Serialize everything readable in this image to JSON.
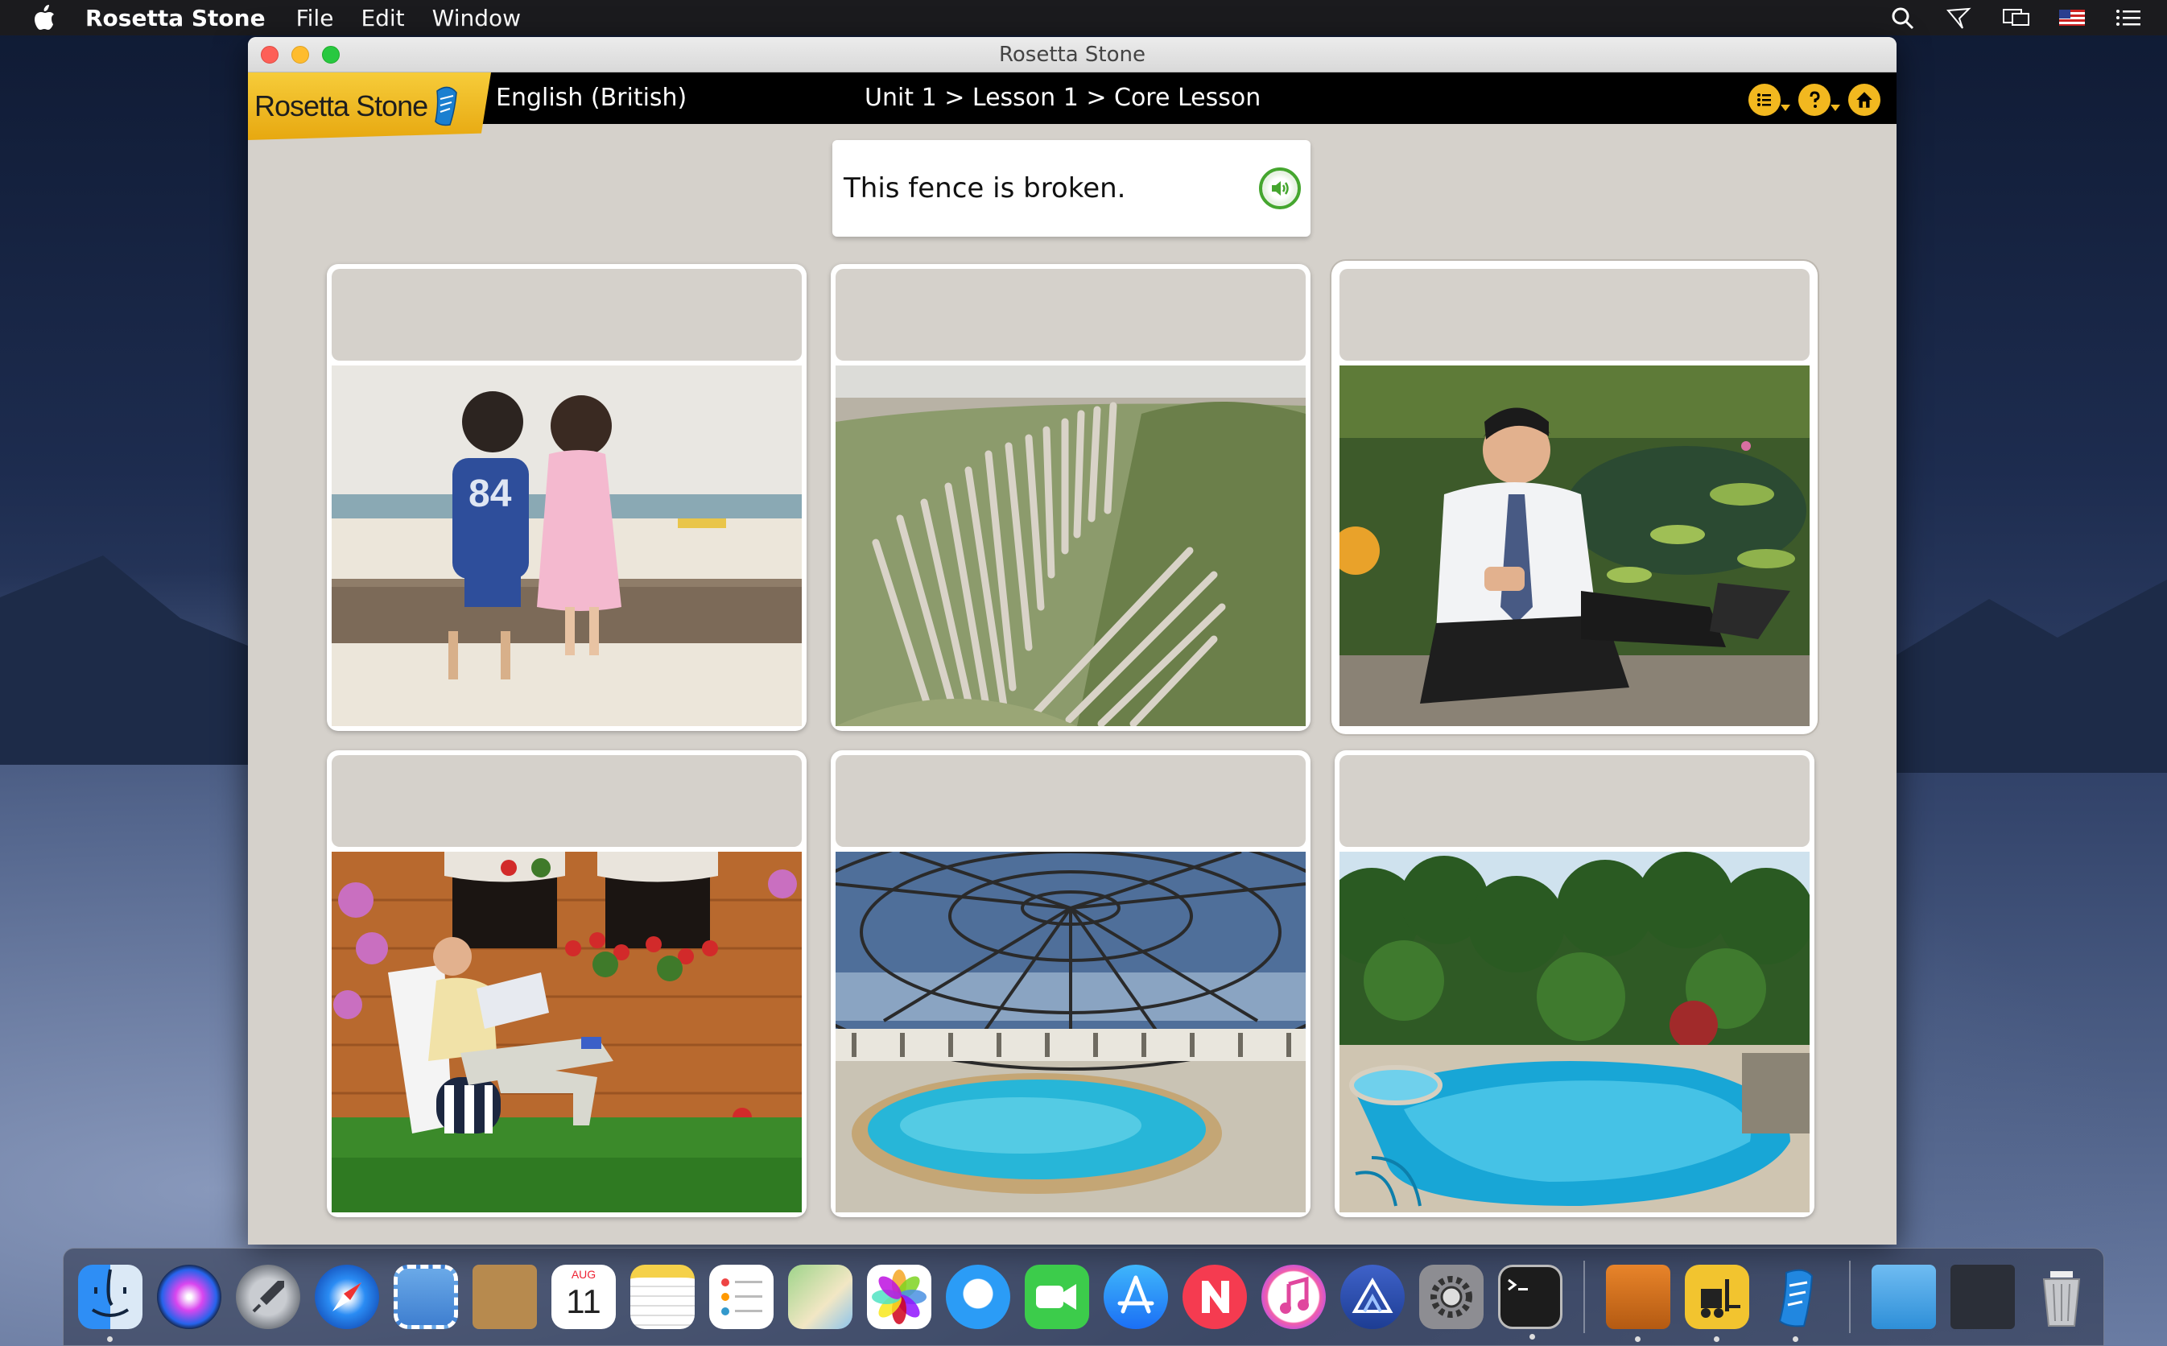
{
  "menubar": {
    "app_name": "Rosetta Stone",
    "menus": [
      "File",
      "Edit",
      "Window"
    ]
  },
  "window": {
    "title": "Rosetta Stone"
  },
  "app": {
    "logo_text": "Rosetta Stone",
    "course": "English (British)",
    "breadcrumb": "Unit 1 > Lesson 1 > Core Lesson"
  },
  "prompt": {
    "text": "This fence is broken."
  },
  "cards": [
    {
      "name": "two-children-on-beach-bench",
      "selected": false
    },
    {
      "name": "broken-fence-in-dunes",
      "selected": false
    },
    {
      "name": "man-with-laptop-by-pond",
      "selected": true
    },
    {
      "name": "man-reading-in-garden-chair",
      "selected": false
    },
    {
      "name": "indoor-pool-under-dome",
      "selected": false
    },
    {
      "name": "outdoor-pool-in-garden",
      "selected": false
    }
  ],
  "dock": {
    "calendar_month": "AUG",
    "calendar_day": "11",
    "apps": [
      "finder",
      "siri",
      "launchpad",
      "safari",
      "mail",
      "contacts",
      "calendar",
      "notes",
      "reminders",
      "maps",
      "photos",
      "messages",
      "facetime",
      "app-store",
      "news",
      "itunes",
      "affinity",
      "system-preferences",
      "terminal",
      "archiver",
      "forklift",
      "rosetta-stone",
      "downloads",
      "screenshots",
      "trash"
    ]
  },
  "colors": {
    "accent_yellow": "#f2b81f",
    "speaker_green": "#45a62f",
    "lesson_bg": "#d5d1cb"
  }
}
